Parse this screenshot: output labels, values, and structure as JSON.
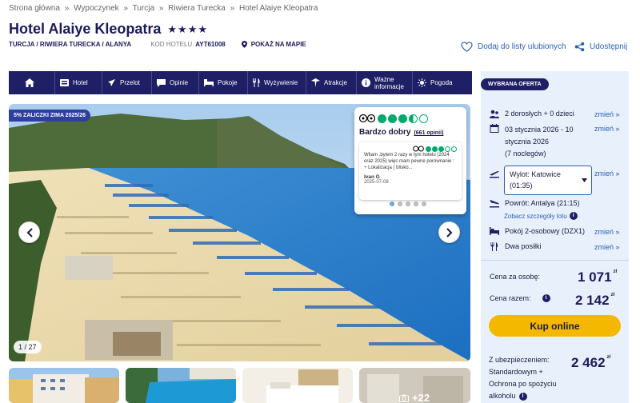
{
  "breadcrumb": [
    "Strona główna",
    "»",
    "Wypoczynek",
    "»",
    "Turcja",
    "»",
    "Riwiera Turecka",
    "»",
    "Hotel Alaiye Kleopatra"
  ],
  "hotel": {
    "name": "Hotel Alaiye Kleopatra",
    "stars": "★★★★",
    "location": "TURCJA / RIWIERA TURECKA / ALANYA",
    "code_label": "KOD HOTELU",
    "code": "AYT61008",
    "map_link": "POKAŻ NA MAPIE"
  },
  "actions": {
    "favorite": "Dodaj do listy ulubionych",
    "share": "Udostępnij"
  },
  "nav": [
    {
      "label": "",
      "icon": "home-icon"
    },
    {
      "label": "Hotel",
      "icon": "hotel-icon"
    },
    {
      "label": "Przelot",
      "icon": "plane-icon"
    },
    {
      "label": "Opinie",
      "icon": "chat-icon"
    },
    {
      "label": "Pokoje",
      "icon": "bed-icon"
    },
    {
      "label": "Wyżywienie",
      "icon": "cutlery-icon"
    },
    {
      "label": "Atrakcje",
      "icon": "attraction-icon"
    },
    {
      "label_1": "Ważne",
      "label_2": "informacje",
      "icon": "info-icon"
    },
    {
      "label": "Pogoda",
      "icon": "sun-icon"
    }
  ],
  "gallery": {
    "promo": "5% ZALICZKI ZIMA 2025/26",
    "counter": "1 / 27",
    "more_photos": "+22"
  },
  "review": {
    "rating_label": "Bardzo dobry",
    "count": "(661 opinii)",
    "rating_fraction": 0.7,
    "text": "Witam ,bylem 2 razy w tym hotelu (2024 oraz 2025) więc mam pewne porównanie : + Lokalizacja ( blisko...",
    "author": "Ivan G",
    "date": "2025-07-08"
  },
  "offer": {
    "badge": "WYBRANA OFERTA",
    "travelers": "2 dorosłych + 0 dzieci",
    "dates_1": "03 stycznia 2026 - 10",
    "dates_2": "stycznia 2026",
    "nights": "(7 noclegów)",
    "departure_1": "Wylot: Katowice",
    "departure_2": "(01:35)",
    "return": "Powrót: Antalya (21:15)",
    "flight_details": "Zobacz szczegóły lotu",
    "room": "Pokój 2-osobowy (DZX1)",
    "meals": "Dwa posiłki",
    "change": "zmień »",
    "price_per_person_label": "Cena za osobę:",
    "price_per_person": "1 071",
    "total_label": "Cena razem:",
    "total": "2 142",
    "currency": "zł",
    "buy": "Kup online",
    "insurance_1": "Z ubezpieczeniem:",
    "insurance_2": "Standardowym +",
    "insurance_3": "Ochrona po spożyciu",
    "insurance_4": "alkoholu",
    "insurance_price": "2 462"
  },
  "colors": {
    "navy": "#1f1f66",
    "accent_blue": "#2b5fb4",
    "buy_yellow": "#f5b800",
    "tripadvisor_green": "#00aa6c",
    "sidebar_bg": "#e8f1fb"
  }
}
